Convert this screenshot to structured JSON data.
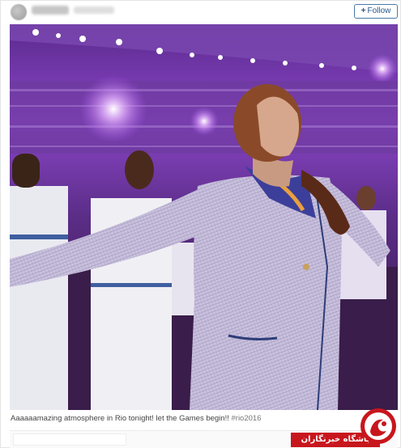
{
  "post": {
    "follow_label": "Follow",
    "caption": "Aaaaaamazing atmosphere in Rio tonight! let the Games begin!! ",
    "hashtag": "#rio2016"
  },
  "watermark": {
    "text": "باشگاه خبرنگاران"
  },
  "icons": {
    "follow": "plus-icon",
    "watermark_logo": "news-agency-logo-icon"
  },
  "colors": {
    "follow_border": "#4a7aa7",
    "stadium_light": "#b06cf0",
    "watermark_red": "#c8161d"
  }
}
